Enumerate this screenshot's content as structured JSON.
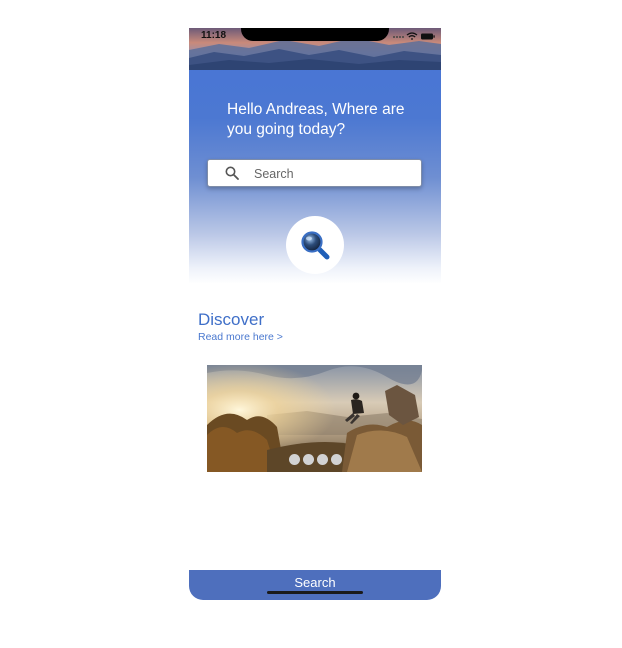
{
  "status_bar": {
    "time": "11:18",
    "icons": [
      "signal-dots-icon",
      "wifi-icon",
      "battery-icon"
    ]
  },
  "hero": {
    "image": "mountain-sunset-photo",
    "greeting": "Hello Andreas, Where are you going today?"
  },
  "search": {
    "placeholder": "Search",
    "value": "",
    "icon": "search-icon"
  },
  "magnifier_button": {
    "icon": "magnifier-icon"
  },
  "discover": {
    "title": "Discover",
    "link": "Read more here >"
  },
  "carousel": {
    "image": "hiker-sitting-on-cliff-photo",
    "slide_count": 4
  },
  "bottom_bar": {
    "label": "Search"
  },
  "colors": {
    "primary_blue": "#4774d6",
    "link_blue": "#3f6fc8",
    "bottom_bar": "#4e6fbd"
  }
}
